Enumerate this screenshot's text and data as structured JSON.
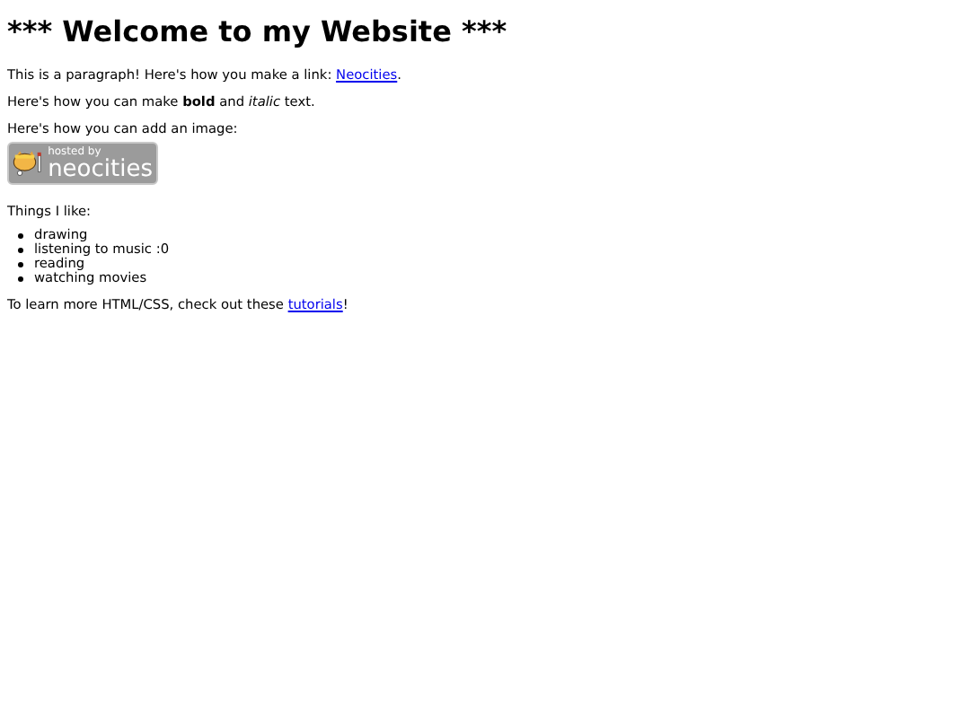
{
  "heading": "*** Welcome to my Website ***",
  "link_paragraph": {
    "before": "This is a paragraph! Here's how you make a link: ",
    "link": "Neocities",
    "after": "."
  },
  "format_paragraph": "Here's how you can make **bold** and *italic* text.",
  "image_paragraph": "Here's how you can add an image:",
  "badge": {
    "line_1": "hosted by",
    "line_2": "neocities"
  },
  "likes_label": "Things I like:",
  "likes": [
    "drawing",
    "listening to music :0",
    "reading",
    "watching movies"
  ],
  "tutorial_paragraph": {
    "before": "To learn more HTML/CSS, check out these ",
    "link": "tutorials",
    "after": "!"
  }
}
